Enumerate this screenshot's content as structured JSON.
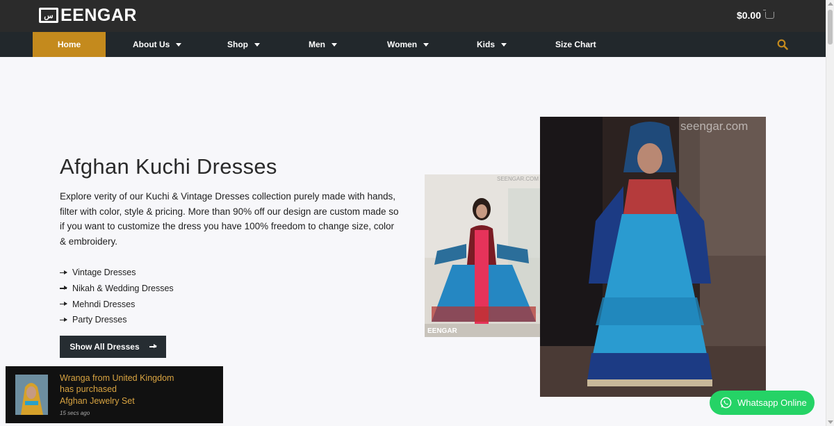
{
  "header": {
    "logo_mark": "س",
    "logo_text": "EENGAR",
    "cart_total": "$0.00",
    "cart_icon": "basket-icon"
  },
  "nav": {
    "items": [
      {
        "label": "Home",
        "active": true
      },
      {
        "label": "About Us",
        "dropdown": true
      },
      {
        "label": "Shop",
        "dropdown": true
      },
      {
        "label": "Men",
        "dropdown": true
      },
      {
        "label": "Women",
        "dropdown": true
      },
      {
        "label": "Kids",
        "dropdown": true
      },
      {
        "label": "Size Chart"
      }
    ],
    "search_icon": "search-icon"
  },
  "hero": {
    "title": "Afghan Kuchi Dresses",
    "description": "Explore verity of our Kuchi & Vintage Dresses collection purely made with hands, filter with color, style & pricing. More than 90% off our design are custom made so if you want to customize the dress you have 100% freedom to change size, color & embroidery.",
    "links": [
      "Vintage Dresses",
      "Nikah & Wedding Dresses",
      "Mehndi Dresses",
      "Party Dresses"
    ],
    "cta_label": "Show All Dresses"
  },
  "images": {
    "small_watermark": "EENGAR",
    "small_watermark_top": "SEENGAR.COM",
    "large_watermark": "seengar.com"
  },
  "popup": {
    "line1": "Wranga from United Kingdom",
    "line2": "has purchased",
    "line3": "Afghan Jewelry Set",
    "time": "15 secs ago"
  },
  "whatsapp": {
    "label": "Whatsapp Online"
  },
  "colors": {
    "accent": "#c48a1d",
    "nav_bg": "#22282c",
    "topbar_bg": "#2b2b2b",
    "whatsapp": "#25d366"
  }
}
